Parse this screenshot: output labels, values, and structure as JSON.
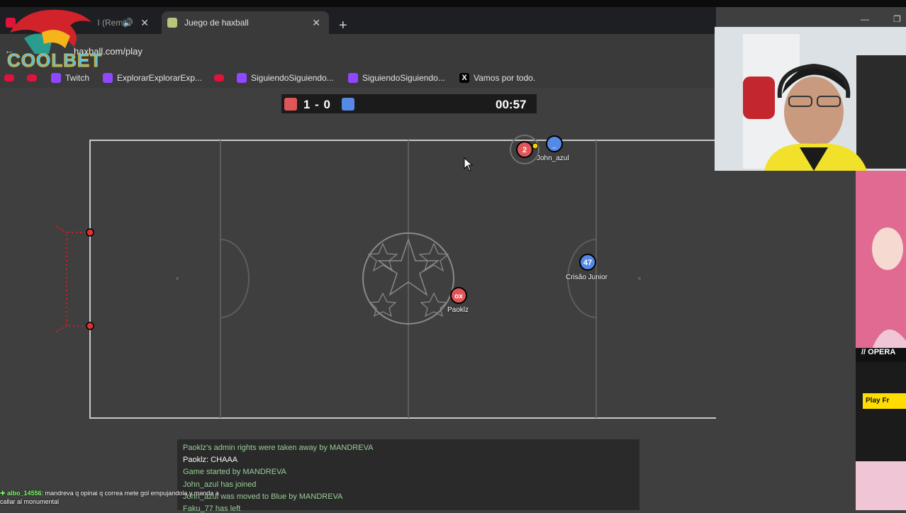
{
  "browser": {
    "tabs": [
      {
        "label": "Ra",
        "label2": "I (Remi",
        "active": false
      },
      {
        "label": "Juego de haxball",
        "active": true
      }
    ],
    "url": "haxball.com/play",
    "bookmarks": [
      {
        "label": "Twitch",
        "icon": "twitch-icon"
      },
      {
        "label": "ExplorarExplorarExp...",
        "icon": "twitch-icon"
      },
      {
        "label": "SiguiendoSiguiendo...",
        "icon": "twitch-icon"
      },
      {
        "label": "SiguiendoSiguiendo...",
        "icon": "twitch-icon"
      },
      {
        "label": "Vamos por todo.",
        "icon": "x-icon"
      }
    ]
  },
  "overlay": {
    "logo_text": "COOLBET"
  },
  "scoreboard": {
    "score": "1 - 0",
    "time": "00:57",
    "red_color": "#e05656",
    "blue_color": "#5689e5"
  },
  "players": [
    {
      "name": "",
      "number": "2",
      "team": "red"
    },
    {
      "name": "John_azul",
      "number": "",
      "team": "blue"
    },
    {
      "name": "Crisão Junior",
      "number": "47",
      "team": "blue"
    },
    {
      "name": "Paoklz",
      "number": "ox",
      "team": "red"
    }
  ],
  "chat": {
    "lines": [
      "Paoklz's admin rights were taken away by MANDREVA",
      "Paoklz: CHAAA",
      "Game started by MANDREVA",
      "John_azul has joined",
      "John_azul was moved to Blue by MANDREVA",
      "Faku_77 has left"
    ]
  },
  "stream_chat": {
    "user": "albo_14556",
    "message": ": mandreva q opinai q correa mete gol empujandola y manda a",
    "message2": "callar al monumental"
  },
  "ad": {
    "banner": "// OPERA",
    "button": "Play Fr"
  }
}
